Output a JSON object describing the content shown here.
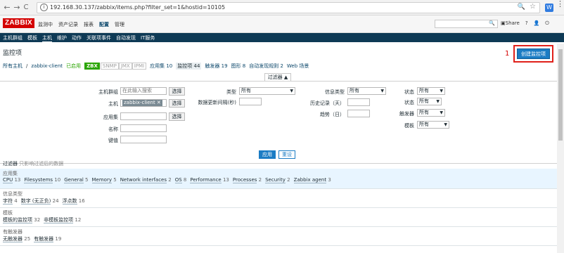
{
  "browser": {
    "url": "192.168.30.137/zabbix/items.php?filter_set=1&hostid=10105",
    "back": "←",
    "forward": "→",
    "reload": "C",
    "home": "⌂",
    "info": "i",
    "zoom": "🔍",
    "star": "☆",
    "ext": "W",
    "menu": "⋮"
  },
  "header": {
    "logo": "ZABBIX",
    "topmenu": [
      "监测中",
      "资产记录",
      "报表",
      "配置",
      "管理"
    ],
    "active_top": "配置",
    "search_icon": "🔍",
    "share": "Share",
    "help": "?",
    "user": "👤",
    "power": "⏻"
  },
  "submenu": {
    "items": [
      "主机群组",
      "模板",
      "主机",
      "维护",
      "动作",
      "关联项事件",
      "自动发现",
      "IT服务"
    ],
    "active": "主机"
  },
  "page": {
    "title": "监控项",
    "marker": "1",
    "create_button": "创建监控项"
  },
  "breadcrumb": {
    "all_hosts": "所有主机",
    "sep": "/",
    "host": "zabbix-client",
    "enabled": "已启用",
    "zbx": "ZBX",
    "snmp": "SNMP",
    "jmx": "JMX",
    "ipmi": "IPMI",
    "apps": "应用集 10",
    "items": "监控项 44",
    "triggers": "触发器 19",
    "graphs": "图形 8",
    "discovery": "自动发现规则 2",
    "web": "Web 场景"
  },
  "filter": {
    "tab_label": "过滤器 ▲",
    "host_group_label": "主机群组",
    "host_group_placeholder": "在此输入搜索",
    "select": "选择",
    "host_label": "主机",
    "host_chip": "zabbix-client ✕",
    "app_label": "应用集",
    "name_label": "名称",
    "key_label": "键值",
    "type_label": "类型",
    "type_value": "所有",
    "interval_label": "数据更新间隔(秒)",
    "info_type_label": "信息类型",
    "info_type_value": "所有",
    "history_label": "历史记录（天）",
    "trends_label": "趋势（日）",
    "state_label": "状态",
    "state_value": "所有",
    "status_label": "状态",
    "status_value": "所有",
    "triggers_label": "触发器",
    "triggers_value": "所有",
    "template_label": "模板",
    "template_value": "所有",
    "apply": "应用",
    "reset": "重设"
  },
  "subfilter": {
    "header": "过滤器",
    "note": "只影响过滤后的数据",
    "groups": [
      {
        "title": "应用集",
        "values": [
          {
            "name": "CPU",
            "count": "13"
          },
          {
            "name": "Filesystems",
            "count": "10"
          },
          {
            "name": "General",
            "count": "5"
          },
          {
            "name": "Memory",
            "count": "5"
          },
          {
            "name": "Network interfaces",
            "count": "2"
          },
          {
            "name": "OS",
            "count": "8"
          },
          {
            "name": "Performance",
            "count": "13"
          },
          {
            "name": "Processes",
            "count": "2"
          },
          {
            "name": "Security",
            "count": "2"
          },
          {
            "name": "Zabbix agent",
            "count": "3"
          }
        ]
      },
      {
        "title": "信息类型",
        "values": [
          {
            "name": "字符",
            "count": "4"
          },
          {
            "name": "数字 (无正负)",
            "count": "24"
          },
          {
            "name": "浮点数",
            "count": "16"
          }
        ]
      },
      {
        "title": "模板",
        "values": [
          {
            "name": "模板的监控项",
            "count": "32"
          },
          {
            "name": "非模板监控项",
            "count": "12"
          }
        ]
      },
      {
        "title": "有触发器",
        "values": [
          {
            "name": "无触发器",
            "count": "25"
          },
          {
            "name": "有触发器",
            "count": "19"
          }
        ]
      }
    ]
  }
}
